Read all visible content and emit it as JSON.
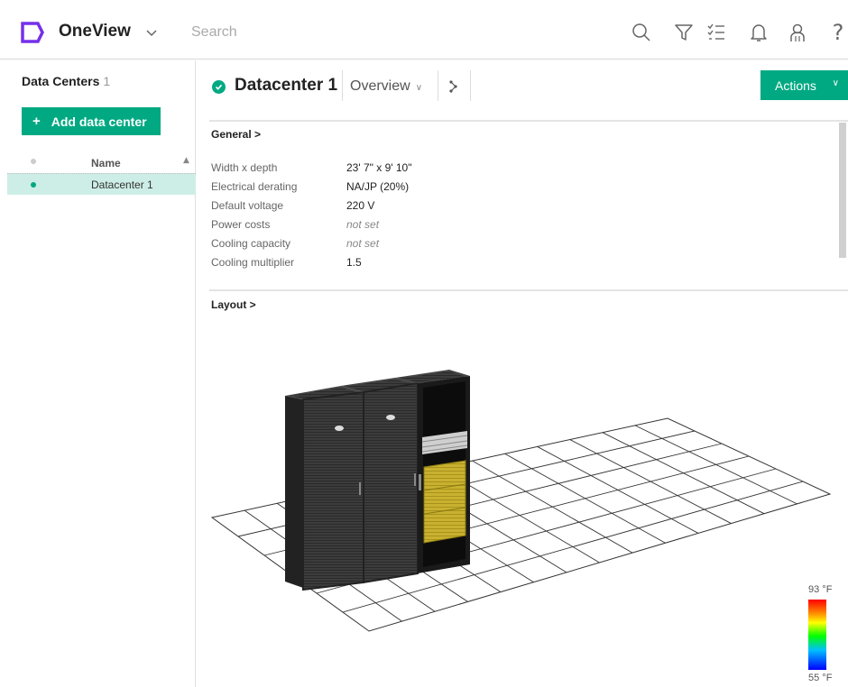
{
  "topbar": {
    "app_name": "OneView",
    "search_placeholder": "Search"
  },
  "left_panel": {
    "title": "Data Centers",
    "count": "1",
    "add_button": "Add data center",
    "add_button_prefix": "+",
    "column_name": "Name",
    "items": [
      {
        "label": "Datacenter 1",
        "status": "ok"
      }
    ]
  },
  "main": {
    "title": "Datacenter 1",
    "view_selector": "Overview",
    "actions_label": "Actions"
  },
  "general": {
    "title": "General >",
    "properties": [
      {
        "label": "Width x depth",
        "value": "23' 7\" x 9' 10\"",
        "unset": false
      },
      {
        "label": "Electrical derating",
        "value": "NA/JP (20%)",
        "unset": false
      },
      {
        "label": "Default voltage",
        "value": "220 V",
        "unset": false
      },
      {
        "label": "Power costs",
        "value": "not set",
        "unset": true
      },
      {
        "label": "Cooling capacity",
        "value": "not set",
        "unset": true
      },
      {
        "label": "Cooling multiplier",
        "value": "1.5",
        "unset": false
      }
    ]
  },
  "layout": {
    "title": "Layout >",
    "legend_max": "93 °F",
    "legend_min": "55 °F"
  },
  "colors": {
    "accent": "#01a982",
    "logo": "#7630ea",
    "selected_row": "#cdeee6"
  }
}
